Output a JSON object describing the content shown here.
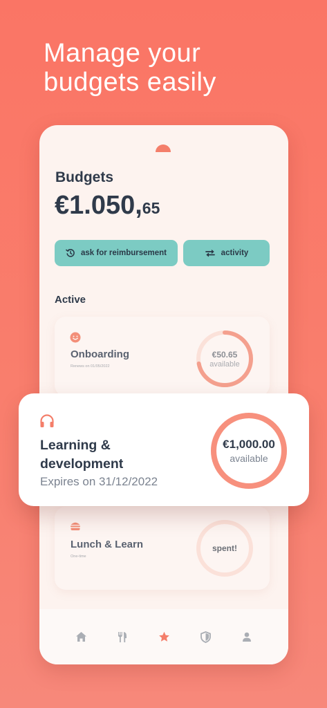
{
  "headline": {
    "line1": "Manage your",
    "line2": "budgets easily"
  },
  "budgets": {
    "title": "Budgets",
    "balance_main": "€1.050,",
    "balance_cents": "65"
  },
  "actions": {
    "reimbursement_label": "ask for reimbursement",
    "activity_label": "activity"
  },
  "active_section": {
    "label": "Active"
  },
  "cards": [
    {
      "icon": "smiley-icon",
      "title": "Onboarding",
      "subtitle": "Renews on 01/05/2022",
      "amount": "€50.65",
      "status": "available",
      "progress": 0.72
    },
    {
      "icon": "headphones-icon",
      "title_line1": "Learning &",
      "title_line2": "development",
      "expiry": "Expires on 31/12/2022",
      "amount": "€1,000.00",
      "status": "available",
      "progress": 1.0
    },
    {
      "icon": "burger-icon",
      "title": "Lunch & Learn",
      "subtitle": "One-time",
      "status": "spent!",
      "progress": 0.0
    }
  ],
  "tabbar": {
    "items": [
      "home-icon",
      "cutlery-icon",
      "star-icon",
      "shield-icon",
      "profile-icon"
    ],
    "active": "star-icon"
  },
  "colors": {
    "background": "#fa7565",
    "accent": "#f47e6a",
    "teal": "#7ccbc3",
    "text_dark": "#2f3a4a",
    "ring_track": "#fbe1d9"
  }
}
